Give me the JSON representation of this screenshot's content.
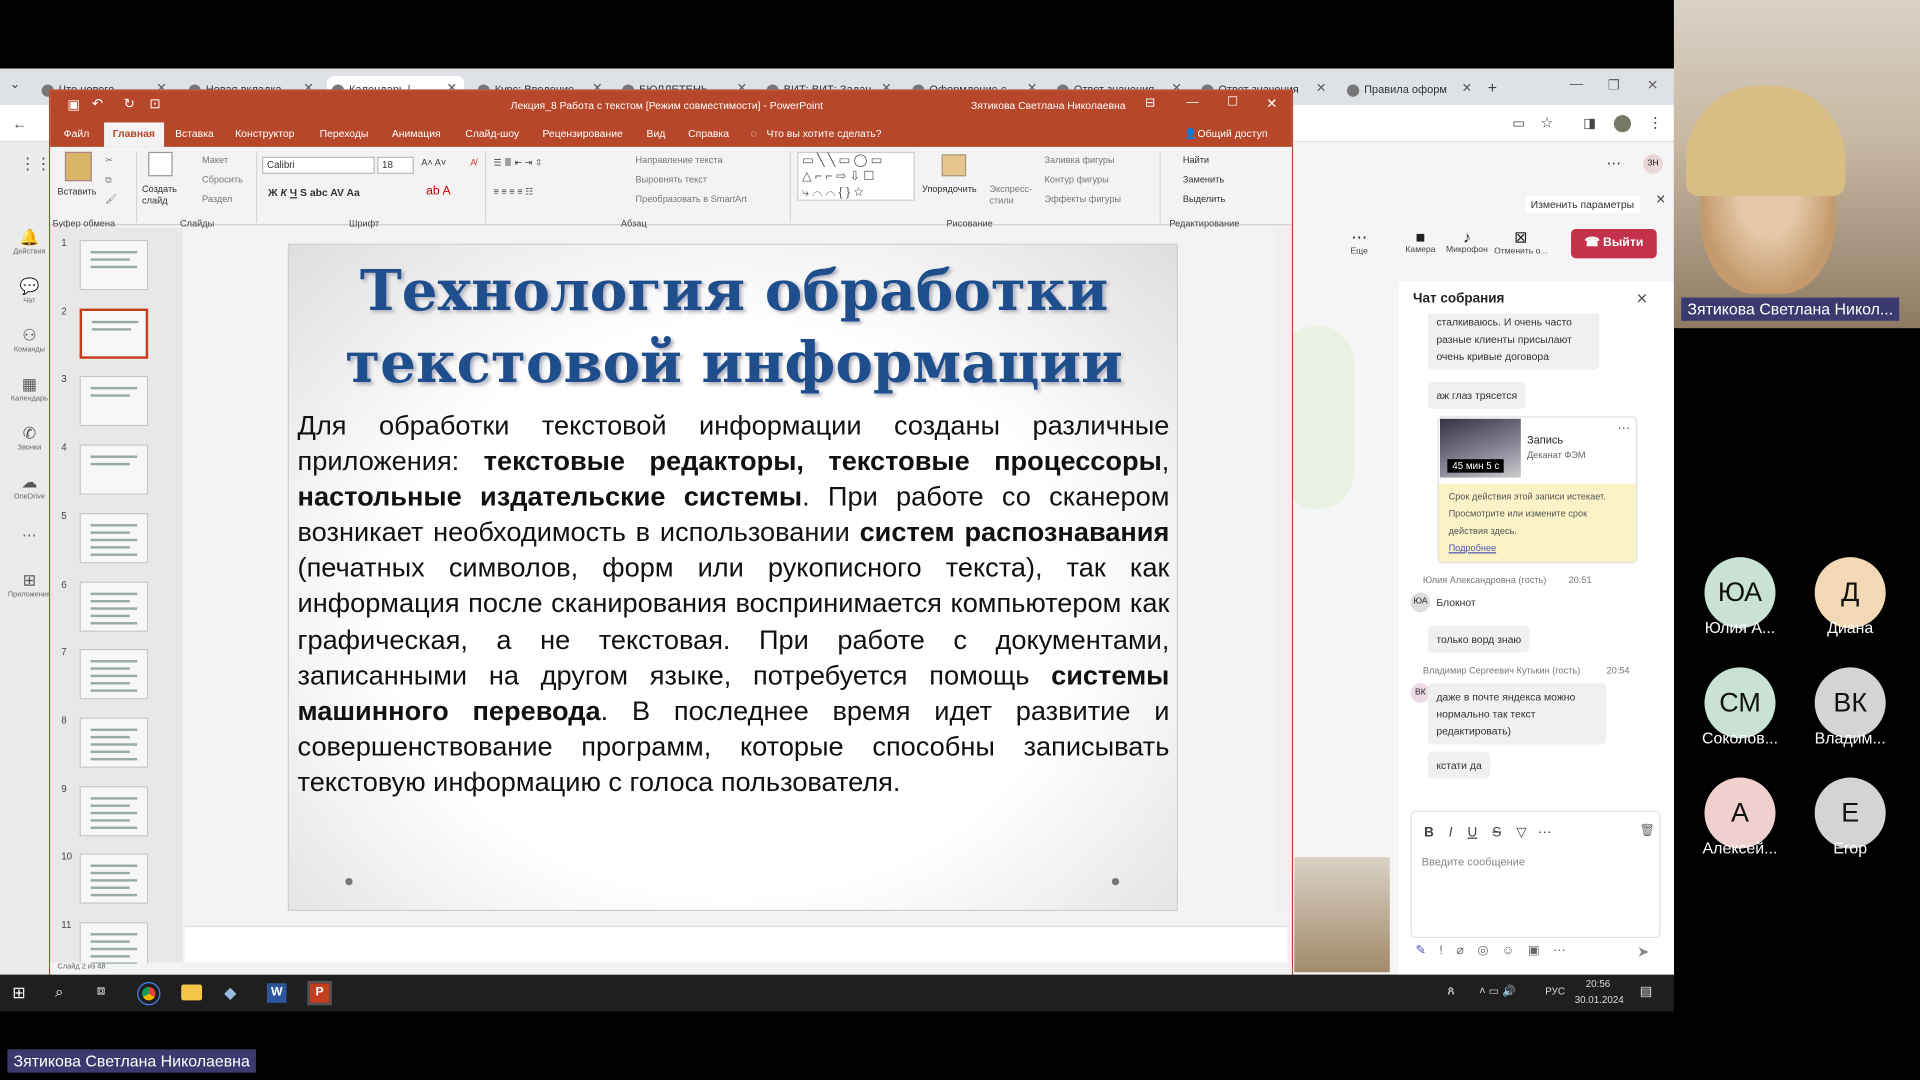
{
  "browser": {
    "tabs": [
      {
        "label": "Что нового"
      },
      {
        "label": "Новая вкладка"
      },
      {
        "label": "Календарь |"
      },
      {
        "label": "Курс: Введение"
      },
      {
        "label": "БЮЛЛЕТЕНЬ"
      },
      {
        "label": "ВИТ: ВИТ: Задан"
      },
      {
        "label": "Оформление с"
      },
      {
        "label": "Ответ значения"
      },
      {
        "label": "Ответ значения"
      },
      {
        "label": "Правила оформ"
      }
    ]
  },
  "teams_rail": [
    {
      "label": "Действия",
      "icon": "bell-icon"
    },
    {
      "label": "Чат",
      "icon": "chat-icon"
    },
    {
      "label": "Команды",
      "icon": "teams-icon"
    },
    {
      "label": "Календарь",
      "icon": "calendar-icon"
    },
    {
      "label": "Звонки",
      "icon": "phone-icon"
    },
    {
      "label": "OneDrive",
      "icon": "cloud-icon"
    },
    {
      "label": "Приложения",
      "icon": "apps-icon"
    }
  ],
  "ppt": {
    "window_title": "Лекция_8 Работа с текстом [Режим совместимости] - PowerPoint",
    "user": "Зятикова Светлана Николаевна",
    "menu": [
      "Файл",
      "Главная",
      "Вставка",
      "Конструктор",
      "Переходы",
      "Анимация",
      "Слайд-шоу",
      "Рецензирование",
      "Вид",
      "Справка"
    ],
    "tell_me": "Что вы хотите сделать?",
    "share": "Общий доступ",
    "ribbon": {
      "paste": "Вставить",
      "new_slide": "Создать слайд",
      "layout": "Макет",
      "reset": "Сбросить",
      "section": "Раздел",
      "font_name": "Calibri",
      "font_size": "18",
      "text_direction": "Направление текста",
      "align_text": "Выровнять текст",
      "smartart": "Преобразовать в SmartArt",
      "arrange": "Упорядочить",
      "quick_styles": "Экспресс-стили",
      "shape_fill": "Заливка фигуры",
      "shape_outline": "Контур фигуры",
      "shape_effects": "Эффекты фигуры",
      "find": "Найти",
      "replace": "Заменить",
      "select": "Выделить",
      "groups": [
        "Буфер обмена",
        "Слайды",
        "Шрифт",
        "Абзац",
        "Рисование",
        "Редактирование"
      ]
    },
    "slide_numbers": [
      "1",
      "2",
      "3",
      "4",
      "5",
      "6",
      "7",
      "8",
      "9",
      "10",
      "11"
    ],
    "selected_slide": 2,
    "slide": {
      "title_line1": "Технология обработки",
      "title_line2": "текстовой информации",
      "body": [
        {
          "t": "Для обработки текстовой информации созданы различные приложения: ",
          "b": false
        },
        {
          "t": "текстовые редакторы, текстовые процессоры",
          "b": true
        },
        {
          "t": ",  ",
          "b": false
        },
        {
          "t": "настольные издательские системы",
          "b": true
        },
        {
          "t": ". При работе со сканером возникает необходимость в использовании ",
          "b": false
        },
        {
          "t": "систем распознавания",
          "b": true
        },
        {
          "t": " (печатных символов, форм или рукописного текста), так как информация после сканирования воспринимается компьютером как графическая, а не текстовая. При работе с документами, записанными на другом языке, потребуется помощь ",
          "b": false
        },
        {
          "t": "системы машинного перевода",
          "b": true
        },
        {
          "t": ". В последнее время идет развитие и совершенствование программ, которые способны записывать текстовую информацию с голоса пользователя.",
          "b": false
        }
      ]
    },
    "status_left": "Слайд 2 из 48"
  },
  "meeting": {
    "change_params": "Изменить параметры",
    "controls": [
      {
        "label": "Еще",
        "icon": "more-icon"
      },
      {
        "label": "Камера",
        "icon": "camera-icon"
      },
      {
        "label": "Микрофон",
        "icon": "mic-icon"
      },
      {
        "label": "Отменить о...",
        "icon": "share-stop-icon"
      }
    ],
    "leave": "Выйти",
    "chat_title": "Чат собрания",
    "messages": [
      {
        "text": "сталкиваюсь. И очень часто разные клиенты присылают очень кривые договора"
      },
      {
        "text": "аж глаз трясется"
      }
    ],
    "recording": {
      "title": "Запись",
      "subtitle": "Деканат ФЭМ",
      "duration": "45 мин 5 с",
      "notice": "Срок действия этой записи истекает. Просмотрите или измените срок действия здесь.",
      "more": "Подробнее"
    },
    "msg_group2": {
      "author": "Юлия Александровна (гость)",
      "time": "20:51",
      "initials": "ЮА",
      "lines": [
        "Блокнот",
        "только ворд знаю"
      ]
    },
    "msg_group3": {
      "author": "Владимир Сергеевич Кутькин (гость)",
      "time": "20:54",
      "initials": "ВК",
      "lines": [
        "даже в почте яндекса можно нормально так текст редактировать)",
        "кстати да"
      ]
    },
    "compose_placeholder": "Введите сообщение",
    "participants": [
      {
        "initials": "ЮА",
        "name": "Юлия А...",
        "color": "#c9e2d3"
      },
      {
        "initials": "Д",
        "name": "Диана",
        "color": "#f2d8b4"
      },
      {
        "initials": "СМ",
        "name": "Соколов...",
        "color": "#c9e2d3"
      },
      {
        "initials": "ВК",
        "name": "Владим...",
        "color": "#d4d4d4"
      },
      {
        "initials": "А",
        "name": "Алексей...",
        "color": "#f0cfcf"
      },
      {
        "initials": "Е",
        "name": "Егор",
        "color": "#d4d4d4"
      }
    ],
    "presenter_cam_name": "Зятикова Светлана Никол...",
    "presenter_name": "Зятикова Светлана Николаевна"
  },
  "taskbar": {
    "time": "20:56",
    "date": "30.01.2024",
    "lang": "РУС"
  },
  "colors": {
    "ppt_accent": "#b7472a",
    "title_blue": "#1f4e8c",
    "leave_red": "#c4314b",
    "teams_purple": "#3b3a6e"
  }
}
